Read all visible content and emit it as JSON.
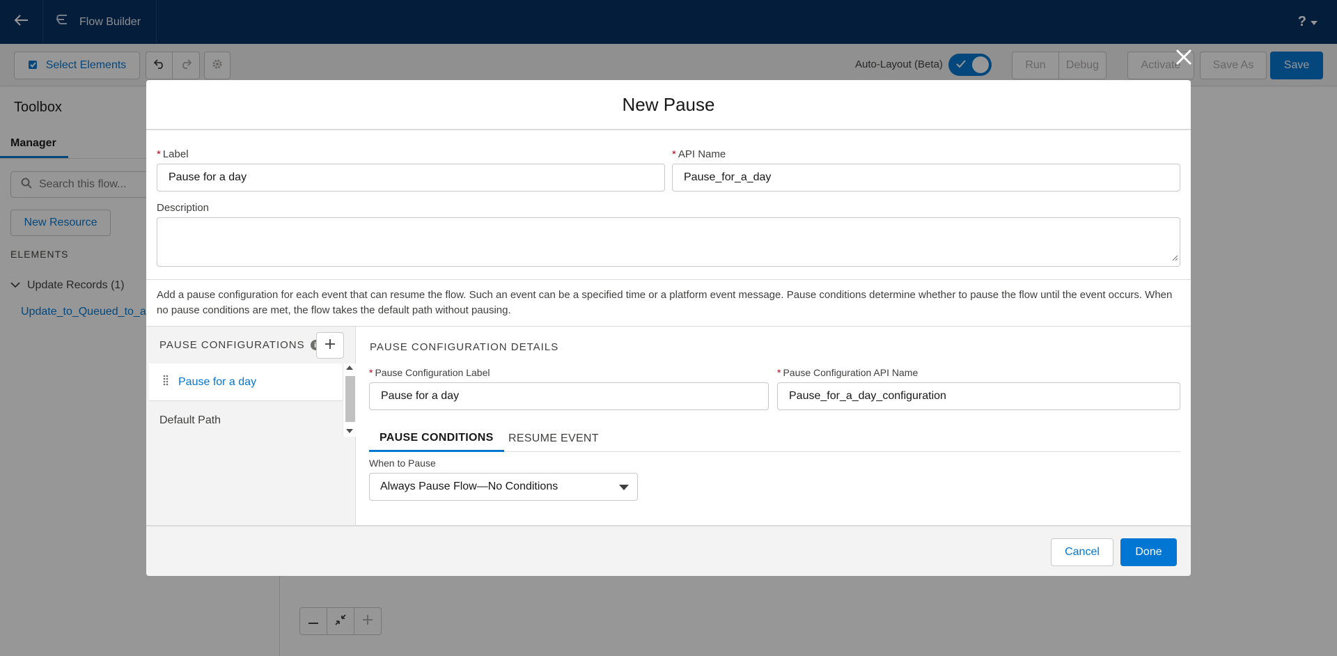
{
  "colors": {
    "brand_blue": "#0176d3",
    "header_navy": "#032d60",
    "required_red": "#ba0517"
  },
  "header": {
    "app_title": "Flow Builder",
    "help_icon": "question-mark-icon"
  },
  "toolbar": {
    "select_elements_label": "Select Elements",
    "auto_layout_label": "Auto-Layout (Beta)",
    "auto_layout_on": true,
    "run_label": "Run",
    "debug_label": "Debug",
    "activate_label": "Activate",
    "save_as_label": "Save As",
    "save_label": "Save"
  },
  "sidebar": {
    "title": "Toolbox",
    "tab_manager": "Manager",
    "search_placeholder": "Search this flow...",
    "new_resource_label": "New Resource",
    "elements_heading": "ELEMENTS",
    "group_label": "Update Records (1)",
    "group_item": "Update_to_Queued_to_add"
  },
  "modal": {
    "title": "New Pause",
    "label_field": {
      "label": "Label",
      "value": "Pause for a day"
    },
    "api_name_field": {
      "label": "API Name",
      "value": "Pause_for_a_day"
    },
    "description_field": {
      "label": "Description",
      "value": ""
    },
    "help_text": "Add a pause configuration for each event that can resume the flow. Such an event can be a specified time or a platform event message. Pause conditions determine whether to pause the flow until the event occurs. When no pause conditions are met, the flow takes the default path without pausing.",
    "configs": {
      "heading": "PAUSE CONFIGURATIONS",
      "items": [
        {
          "label": "Pause for a day"
        }
      ],
      "default_path": "Default Path"
    },
    "details": {
      "heading": "PAUSE CONFIGURATION DETAILS",
      "config_label_field": {
        "label": "Pause Configuration Label",
        "value": "Pause for a day"
      },
      "config_api_field": {
        "label": "Pause Configuration API Name",
        "value": "Pause_for_a_day_configuration"
      },
      "tabs": [
        {
          "label": "PAUSE CONDITIONS",
          "active": true
        },
        {
          "label": "RESUME EVENT",
          "active": false
        }
      ],
      "when_to_pause": {
        "label": "When to Pause",
        "value": "Always Pause Flow—No Conditions"
      }
    },
    "footer": {
      "cancel_label": "Cancel",
      "done_label": "Done"
    }
  }
}
